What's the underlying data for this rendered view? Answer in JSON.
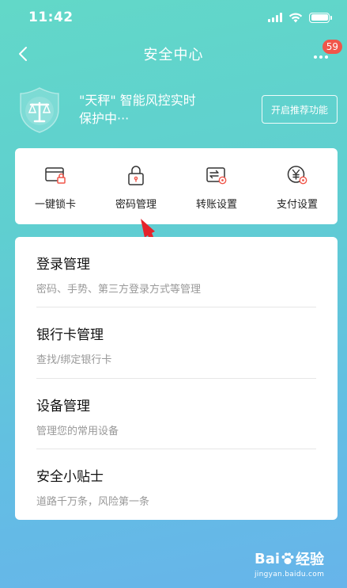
{
  "status_bar": {
    "time": "11:42"
  },
  "nav": {
    "title": "安全中心",
    "badge_count": "59"
  },
  "hero": {
    "line1": "\"天秤\" 智能风控实时",
    "line2": "保护中···",
    "button_label": "开启推荐功能"
  },
  "quick_actions": [
    {
      "label": "一键锁卡",
      "icon": "card-lock-icon"
    },
    {
      "label": "密码管理",
      "icon": "padlock-icon"
    },
    {
      "label": "转账设置",
      "icon": "transfer-icon"
    },
    {
      "label": "支付设置",
      "icon": "payment-yen-icon"
    }
  ],
  "settings": [
    {
      "title": "登录管理",
      "desc": "密码、手势、第三方登录方式等管理"
    },
    {
      "title": "银行卡管理",
      "desc": "查找/绑定银行卡"
    },
    {
      "title": "设备管理",
      "desc": "管理您的常用设备"
    },
    {
      "title": "安全小贴士",
      "desc": "道路千万条，风险第一条"
    }
  ],
  "watermark": {
    "brand_a": "Bai",
    "brand_b": "经验",
    "url": "jingyan.baidu.com"
  },
  "colors": {
    "accent": "#f0564a",
    "gradient_top": "#62d8c8",
    "gradient_bottom": "#67b4ea"
  }
}
